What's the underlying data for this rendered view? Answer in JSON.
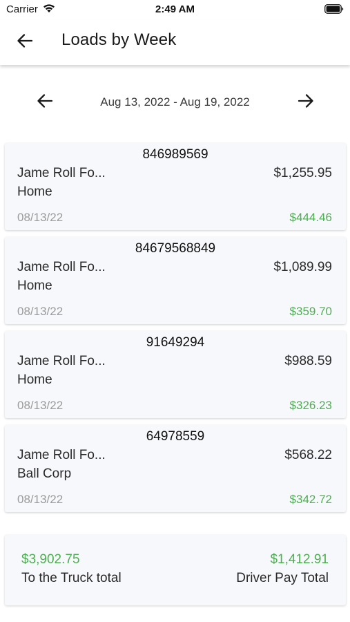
{
  "status_bar": {
    "carrier": "Carrier",
    "time": "2:49 AM",
    "icons": [
      "wifi-icon",
      "battery-icon"
    ]
  },
  "app_bar": {
    "back_icon": "arrow-left-icon",
    "title": "Loads by Week"
  },
  "week_nav": {
    "prev_icon": "arrow-left-icon",
    "range": "Aug 13, 2022 - Aug 19, 2022",
    "next_icon": "arrow-right-icon"
  },
  "loads": [
    {
      "number": "846989569",
      "customer": "Jame Roll Fo...",
      "destination": "Home",
      "gross": "$1,255.95",
      "date": "08/13/22",
      "driver_pay": "$444.46"
    },
    {
      "number": "84679568849",
      "customer": "Jame Roll Fo...",
      "destination": "Home",
      "gross": "$1,089.99",
      "date": "08/13/22",
      "driver_pay": "$359.70"
    },
    {
      "number": "91649294",
      "customer": "Jame Roll Fo...",
      "destination": "Home",
      "gross": "$988.59",
      "date": "08/13/22",
      "driver_pay": "$326.23"
    },
    {
      "number": "64978559",
      "customer": "Jame Roll Fo...",
      "destination": "Ball Corp",
      "gross": "$568.22",
      "date": "08/13/22",
      "driver_pay": "$342.72"
    }
  ],
  "totals": {
    "truck_total_value": "$3,902.75",
    "truck_total_label": "To the Truck total",
    "driver_total_value": "$1,412.91",
    "driver_total_label": "Driver Pay Total"
  },
  "colors": {
    "accent_green": "#4caf50",
    "card_background": "#f7f8fb",
    "muted_text": "#9a9a9a"
  }
}
